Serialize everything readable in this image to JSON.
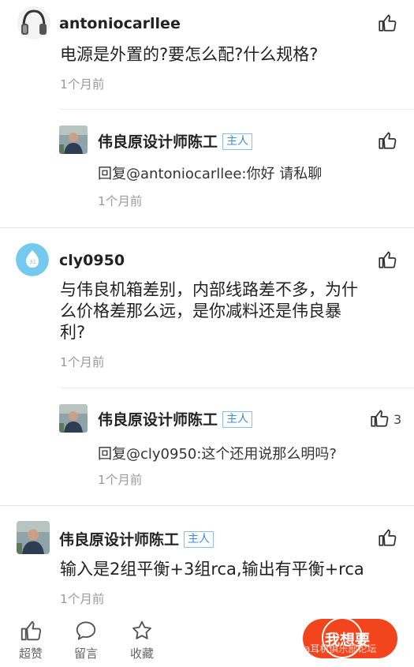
{
  "comments": [
    {
      "username": "antoniocarllee",
      "text": "电源是外置的?要怎么配?什么规格?",
      "time": "1个月前",
      "reply": {
        "username": "伟良原设计师陈工",
        "badge": "主人",
        "text": "回复@antoniocarllee:你好 请私聊",
        "time": "1个月前"
      }
    },
    {
      "username": "cly0950",
      "text_lines": [
        "与伟良机箱差别，内部线路差不多，为什",
        "么价格差那么远，是你减料还是伟良暴",
        "利?"
      ],
      "time": "1个月前",
      "reply": {
        "username": "伟良原设计师陈工",
        "badge": "主人",
        "text": "回复@cly0950:这个还用说那么明吗?",
        "time": "1个月前",
        "likes": "3"
      }
    },
    {
      "username": "伟良原设计师陈工",
      "badge": "主人",
      "text": "输入是2组平衡+3组rca,输出有平衡+rca",
      "time": "1个月前"
    }
  ],
  "bottom_bar": {
    "like_label": "超赞",
    "comment_label": "留言",
    "favorite_label": "收藏",
    "cta_label": "我想要",
    "watermark": "a耳机俱乐部论坛"
  },
  "colors": {
    "badge": "#3d8bd9",
    "cta": "#f2451e",
    "time": "#9a9a9a"
  },
  "icons": [
    "headphones-avatar",
    "cly-avatar",
    "designer-avatar",
    "thumbs-up-icon",
    "comment-icon",
    "star-icon"
  ]
}
